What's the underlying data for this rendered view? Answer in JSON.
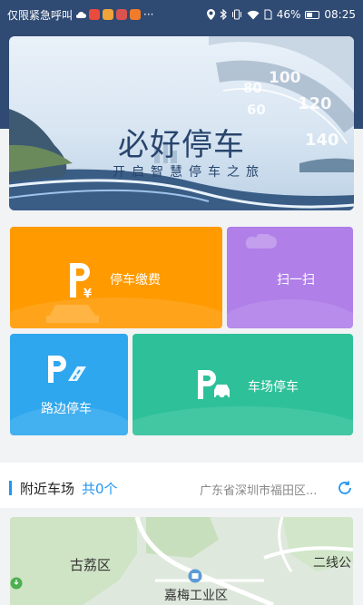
{
  "status_bar": {
    "carrier": "仅限紧急呼叫",
    "battery_percent": "46%",
    "time": "08:25",
    "ellipsis": "···"
  },
  "banner": {
    "title": "必好停车",
    "subtitle": "开启智慧停车之旅",
    "speedometer_labels": [
      "60",
      "80",
      "100",
      "120",
      "140"
    ]
  },
  "tiles": {
    "pay": {
      "label": "停车缴费",
      "icon": "parking-yuan-icon"
    },
    "scan": {
      "label": "扫一扫"
    },
    "roadside": {
      "label": "路边停车",
      "icon": "parking-road-icon"
    },
    "lot": {
      "label": "车场停车",
      "icon": "parking-car-icon"
    }
  },
  "nearby": {
    "title": "附近车场",
    "count": "共0个",
    "location": "广东省深圳市福田区...",
    "accent": "#2196f3"
  },
  "map": {
    "labels": [
      "古荔区",
      "嘉梅工业区",
      "二线公"
    ]
  },
  "colors": {
    "header": "#2f4a73",
    "pay": "#ff9a00",
    "scan": "#b07fe8",
    "roadside": "#2ea7ef",
    "lot": "#2ec199"
  }
}
